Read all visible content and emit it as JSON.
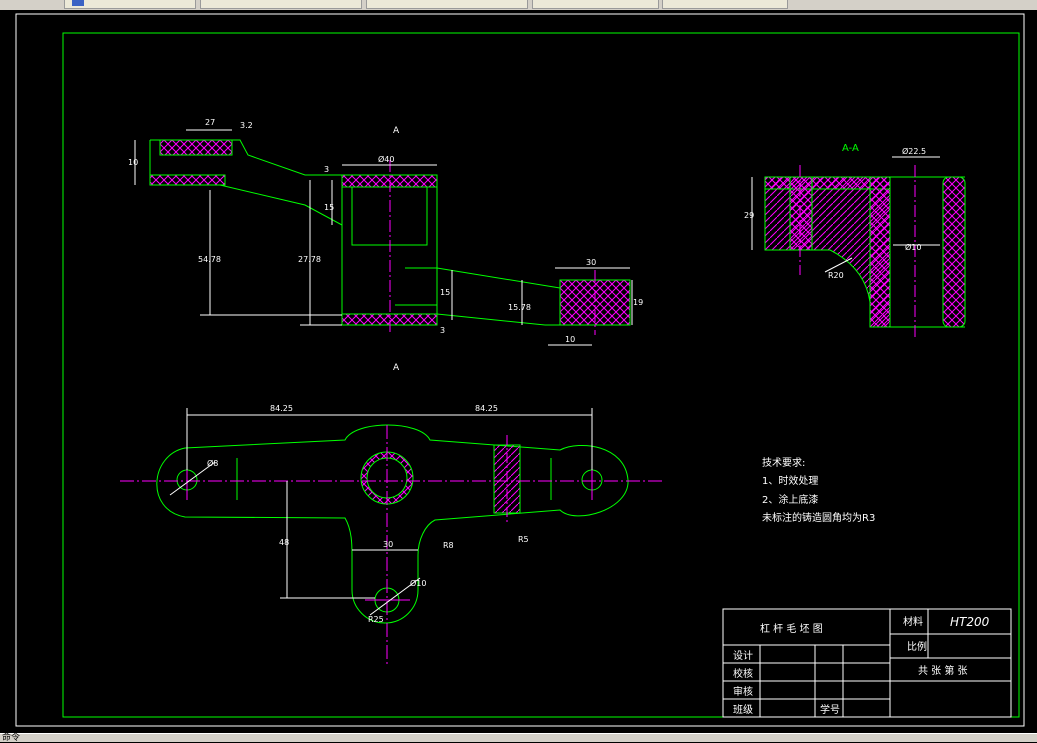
{
  "window": {
    "tabs": [
      "",
      "",
      "",
      "",
      ""
    ],
    "status_text": "命令"
  },
  "drawing": {
    "section_label_top": "A",
    "section_label_bottom": "A",
    "section_view_label": "A-A",
    "dims_front": {
      "d27": "27",
      "d10": "10",
      "ra": "3.2",
      "d40": "Ø40",
      "d3a": "3",
      "d15a": "15",
      "d547": "54.78",
      "d277": "27.78",
      "d15b": "15",
      "d157": "15.78",
      "d3b": "3",
      "d30": "30",
      "d19": "19",
      "d10b": "10"
    },
    "dims_section": {
      "d225": "Ø22.5",
      "d29": "29",
      "d10": "Ø10",
      "r20": "R20"
    },
    "dims_plan": {
      "d8425a": "84.25",
      "d8425b": "84.25",
      "d8": "Ø8",
      "d48": "48",
      "d30": "30",
      "r8": "R8",
      "d10": "Ø10",
      "r25": "R25",
      "r5": "R5"
    },
    "requirements": {
      "title": "技术要求:",
      "item1": "1、时效处理",
      "item2": "2、涂上底漆",
      "item3": "未标注的铸造圆角均为R3"
    },
    "title_block": {
      "part_name": "杠  杆  毛  坯  图",
      "material_label": "材料",
      "material_value": "HT200",
      "scale_label": "比例",
      "sheet_text": "共    张    第    张",
      "design_label": "设计",
      "check_label": "校核",
      "review_label": "审核",
      "class_label": "班级",
      "student_id_label": "学号"
    }
  },
  "colors": {
    "border": "#00ff00",
    "outline": "#00ff00",
    "dimension": "#ffffff",
    "centerline": "#ff00ff",
    "hatch": "#ff00ff",
    "background": "#000000"
  }
}
